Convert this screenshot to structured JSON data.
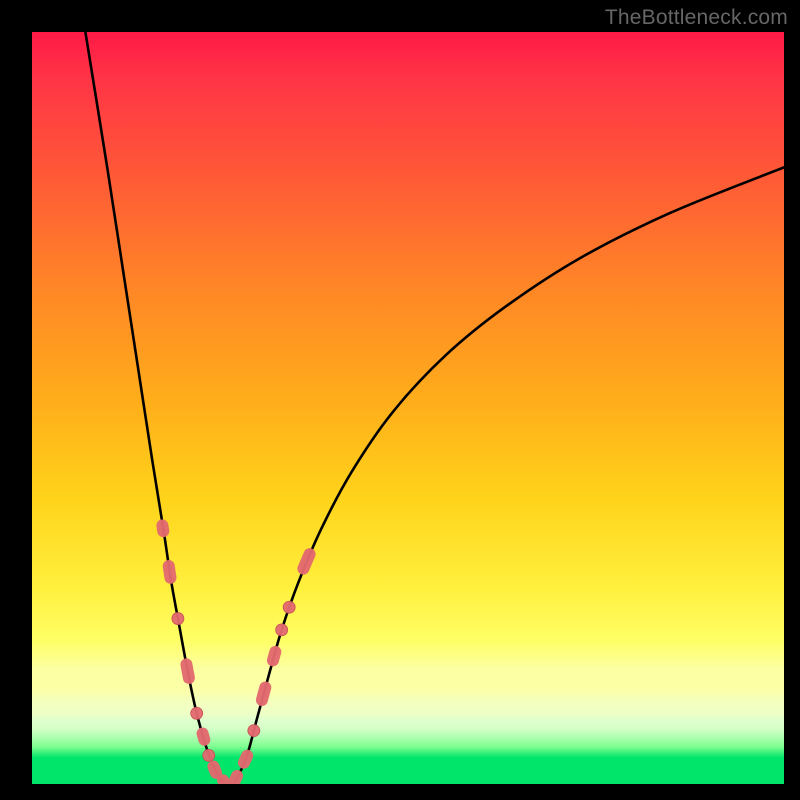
{
  "watermark": {
    "text": "TheBottleneck.com"
  },
  "colors": {
    "background": "#000000",
    "curve_stroke": "#000000",
    "marker_fill": "#e36a6f",
    "marker_stroke": "#c94e55",
    "watermark": "#666666"
  },
  "chart_data": {
    "type": "line",
    "title": "",
    "xlabel": "",
    "ylabel": "",
    "xlim": [
      0,
      100
    ],
    "ylim": [
      0,
      100
    ],
    "grid": false,
    "legend": false,
    "annotations": [
      "TheBottleneck.com"
    ],
    "note": "Axes have no visible tick labels; values are in percent of plot width/height read from the curve geometry.",
    "series": [
      {
        "name": "left-branch",
        "x": [
          7.1,
          10.0,
          12.0,
          14.0,
          16.0,
          17.5,
          18.5,
          19.5,
          20.8,
          22.0,
          23.3,
          24.3,
          25.3
        ],
        "y": [
          100.0,
          82.0,
          69.0,
          56.0,
          43.0,
          33.7,
          27.0,
          21.5,
          14.5,
          9.0,
          4.5,
          2.0,
          0.3
        ]
      },
      {
        "name": "right-branch",
        "x": [
          27.0,
          28.5,
          30.0,
          31.5,
          33.2,
          35.5,
          38.5,
          42.5,
          48.0,
          55.0,
          63.0,
          73.0,
          85.0,
          100.0
        ],
        "y": [
          0.3,
          3.5,
          9.0,
          14.5,
          20.5,
          27.0,
          34.0,
          41.5,
          49.5,
          57.0,
          63.5,
          70.0,
          76.0,
          82.0
        ]
      }
    ],
    "markers": {
      "note": "Pink capsule/round markers placed along both branches near the bottom; lengths indicate capsule elongation along the curve direction (0 = dot).",
      "points": [
        {
          "branch": "left",
          "x": 17.4,
          "y": 34.0,
          "len": 3.0
        },
        {
          "branch": "left",
          "x": 18.3,
          "y": 28.2,
          "len": 6.2
        },
        {
          "branch": "left",
          "x": 19.4,
          "y": 22.0,
          "len": 0.0
        },
        {
          "branch": "left",
          "x": 20.7,
          "y": 15.0,
          "len": 7.2
        },
        {
          "branch": "left",
          "x": 21.9,
          "y": 9.4,
          "len": 0.0
        },
        {
          "branch": "left",
          "x": 22.8,
          "y": 6.3,
          "len": 3.4
        },
        {
          "branch": "left",
          "x": 23.5,
          "y": 3.8,
          "len": 0.0
        },
        {
          "branch": "left",
          "x": 24.3,
          "y": 1.9,
          "len": 3.6
        },
        {
          "branch": "left",
          "x": 25.4,
          "y": 0.5,
          "len": 5.0
        },
        {
          "branch": "right",
          "x": 27.0,
          "y": 0.5,
          "len": 5.0
        },
        {
          "branch": "right",
          "x": 28.4,
          "y": 3.3,
          "len": 4.0
        },
        {
          "branch": "right",
          "x": 29.5,
          "y": 7.1,
          "len": 0.0
        },
        {
          "branch": "right",
          "x": 30.8,
          "y": 12.0,
          "len": 6.8
        },
        {
          "branch": "right",
          "x": 32.2,
          "y": 17.0,
          "len": 4.6
        },
        {
          "branch": "right",
          "x": 33.2,
          "y": 20.5,
          "len": 0.0
        },
        {
          "branch": "right",
          "x": 34.2,
          "y": 23.5,
          "len": 0.0
        },
        {
          "branch": "right",
          "x": 36.5,
          "y": 29.6,
          "len": 8.2
        }
      ]
    }
  }
}
